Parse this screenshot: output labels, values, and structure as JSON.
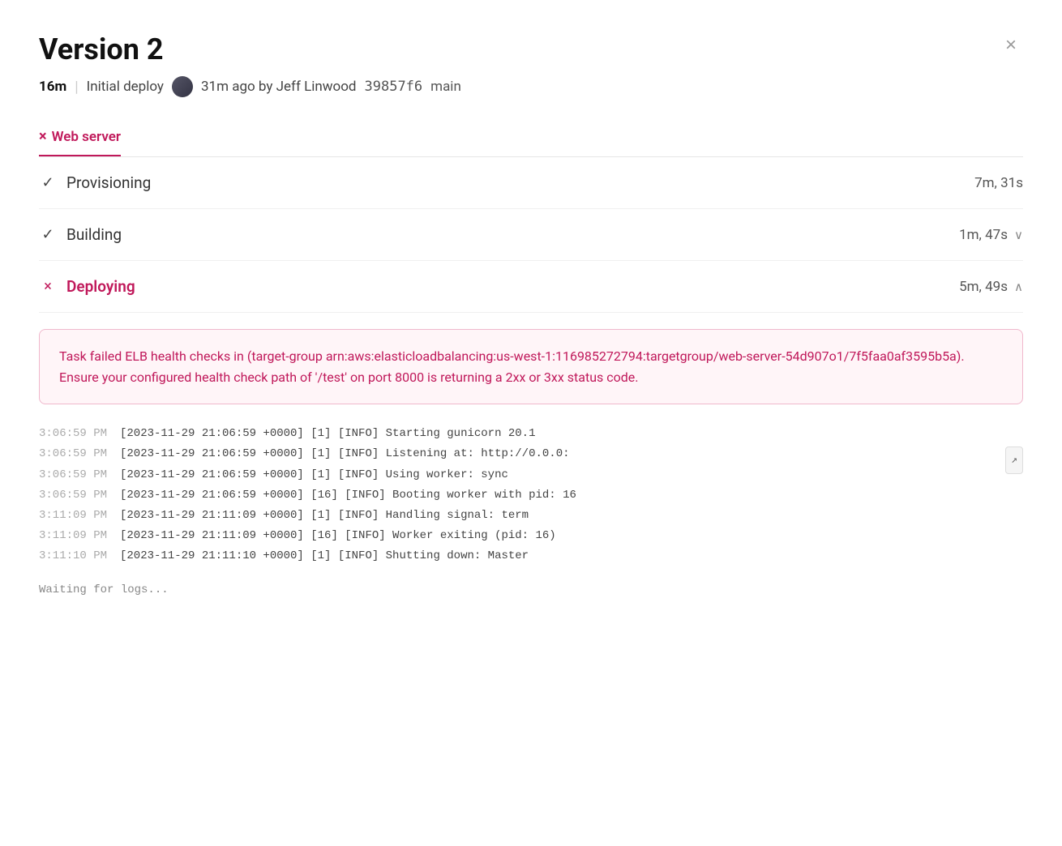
{
  "header": {
    "title": "Version 2",
    "close_label": "×"
  },
  "deploy_meta": {
    "duration": "16m",
    "separator": "|",
    "description": "Initial deploy",
    "time_ago": "31m ago by Jeff Linwood",
    "commit": "39857f6",
    "branch": "main"
  },
  "tabs": [
    {
      "id": "web-server",
      "label": "Web server",
      "icon": "×",
      "active": true
    }
  ],
  "steps": [
    {
      "id": "provisioning",
      "name": "Provisioning",
      "icon": "✓",
      "icon_type": "check",
      "duration": "7m, 31s",
      "has_chevron": false,
      "active": false
    },
    {
      "id": "building",
      "name": "Building",
      "icon": "✓",
      "icon_type": "check",
      "duration": "1m, 47s",
      "has_chevron": true,
      "chevron": "˅",
      "active": false
    },
    {
      "id": "deploying",
      "name": "Deploying",
      "icon": "×",
      "icon_type": "x-red",
      "duration": "5m, 49s",
      "has_chevron": true,
      "chevron": "˄",
      "active": true
    }
  ],
  "error": {
    "text": "Task failed ELB health checks in (target-group arn:aws:elasticloadbalancing:us-west-1:116985272794:targetgroup/web-server-54d907o1/7f5faa0af3595b5a). Ensure your configured health check path of '/test' on port 8000 is returning a 2xx or 3xx status code."
  },
  "logs": [
    {
      "time": "3:06:59 PM",
      "content": "[2023-11-29 21:06:59 +0000] [1]  [INFO] Starting gunicorn 20.1"
    },
    {
      "time": "3:06:59 PM",
      "content": "[2023-11-29 21:06:59 +0000] [1]  [INFO] Listening at: http://0.0.0:"
    },
    {
      "time": "3:06:59 PM",
      "content": "[2023-11-29 21:06:59 +0000] [1]  [INFO] Using worker: sync"
    },
    {
      "time": "3:06:59 PM",
      "content": "[2023-11-29 21:06:59 +0000] [16] [INFO] Booting worker with pid: 16"
    },
    {
      "time": "3:11:09 PM",
      "content": "[2023-11-29 21:11:09 +0000] [1]  [INFO] Handling signal: term"
    },
    {
      "time": "3:11:09 PM",
      "content": "[2023-11-29 21:11:09 +0000] [16] [INFO] Worker exiting (pid: 16)"
    },
    {
      "time": "3:11:10 PM",
      "content": "[2023-11-29 21:11:10 +0000] [1]  [INFO] Shutting down: Master"
    }
  ],
  "waiting_text": "Waiting for logs..."
}
